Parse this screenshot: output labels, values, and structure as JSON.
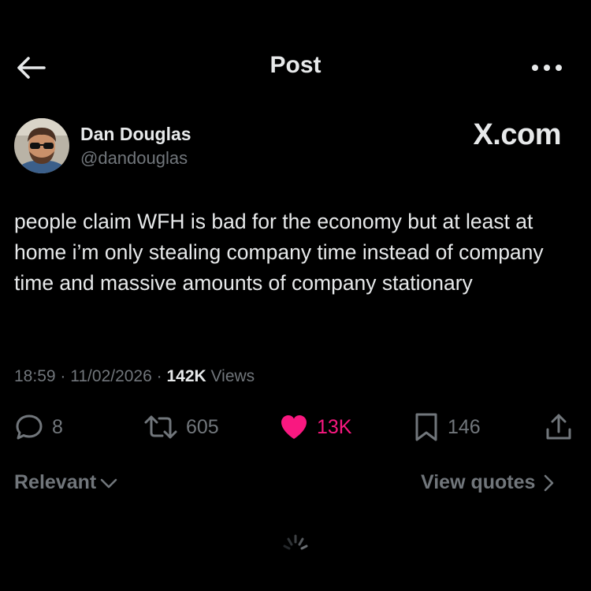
{
  "header": {
    "title": "Post",
    "back_icon": "arrow-left-icon",
    "more_icon": "more-horizontal-icon"
  },
  "author": {
    "name": "Dan Douglas",
    "handle": "@dandouglas"
  },
  "watermark": "X.com",
  "post": {
    "text": "people claim WFH is bad for the economy but at least at home i’m only stealing company time instead of company time and massive amounts of company stationary"
  },
  "meta": {
    "time": "18:59",
    "separator": "·",
    "date": "11/02/2026",
    "views_count": "142K",
    "views_label": "Views"
  },
  "actions": {
    "replies": "8",
    "reposts": "605",
    "likes": "13K",
    "bookmarks": "146",
    "like_color": "#f91880"
  },
  "footer": {
    "sort_label": "Relevant",
    "quotes_label": "View quotes"
  }
}
